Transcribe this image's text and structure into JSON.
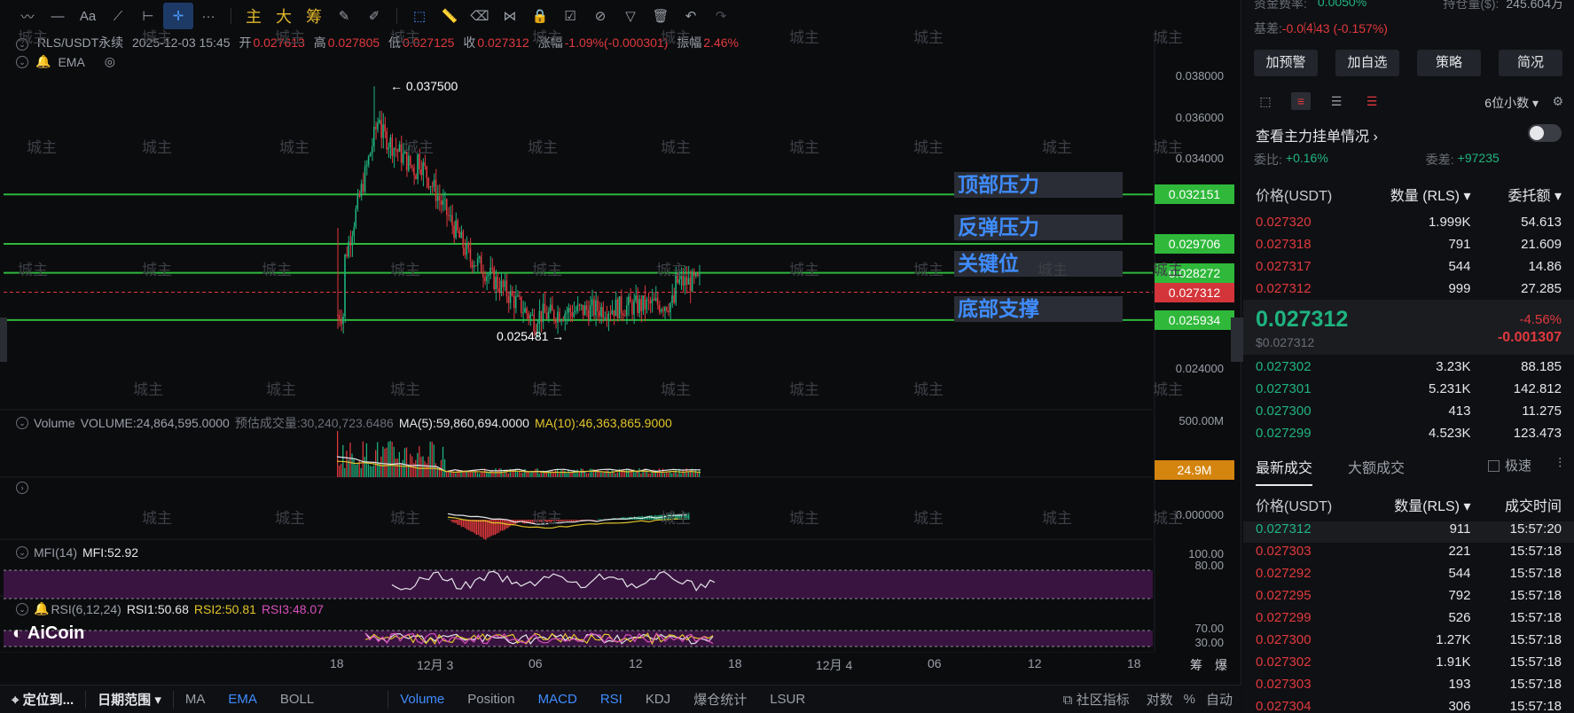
{
  "toolbar": {
    "items": [
      "draw-line",
      "horizontal-line",
      "text",
      "fib",
      "ray",
      "crosshair",
      "more"
    ],
    "highlights": [
      "主",
      "大",
      "筹"
    ]
  },
  "info": {
    "symbol": "RLS/USDT永续",
    "datetime": "2025-12-03 15:45",
    "open_label": "开",
    "open": "0.027613",
    "high_label": "高",
    "high": "0.027805",
    "low_label": "低",
    "low": "0.027125",
    "close_label": "收",
    "close": "0.027312",
    "change_label": "涨幅",
    "change": "-1.09%(-0.000301)",
    "amp_label": "振幅",
    "amp": "2.46%",
    "ema_label": "EMA"
  },
  "price_axis": [
    "0.038000",
    "0.036000",
    "0.034000",
    "0.032151",
    "0.029706",
    "0.028272",
    "0.027312",
    "0.025934",
    "0.024000"
  ],
  "levels": [
    {
      "price": "0.032151",
      "zone": "顶部压力",
      "color": "#2db83d"
    },
    {
      "price": "0.029706",
      "zone": "反弹压力",
      "color": "#2db83d"
    },
    {
      "price": "0.028272",
      "zone": "关键位",
      "color": "#2db83d"
    },
    {
      "price": "0.027312",
      "zone": "",
      "color": "#e0393e"
    },
    {
      "price": "0.025934",
      "zone": "底部支撑",
      "color": "#2db83d"
    }
  ],
  "high_marker": "0.037500",
  "low_marker": "0.025481",
  "volume": {
    "label": "Volume",
    "value": "VOLUME:24,864,595.0000",
    "est": "预估成交量:30,240,723.6486",
    "ma5": "MA(5):59,860,694.0000",
    "ma10": "MA(10):46,363,865.9000",
    "axis_top": "500.00M",
    "current": "24.9M"
  },
  "macd": {
    "axis": "0.000000"
  },
  "mfi": {
    "label": "MFI(14)",
    "value": "MFI:52.92",
    "axis_100": "100.00",
    "axis_80": "80.00"
  },
  "rsi": {
    "label": "RSI(6,12,24)",
    "rsi1": "RSI1:50.68",
    "rsi2": "RSI2:50.81",
    "rsi3": "RSI3:48.07",
    "axis_70": "70.00",
    "axis_30": "30.00"
  },
  "brand": "AiCoin",
  "watermark": "城主",
  "x_axis": [
    "18",
    "12月 3",
    "06",
    "12",
    "18",
    "12月 4",
    "06",
    "12",
    "18"
  ],
  "x_axis_right": [
    "筹",
    "爆"
  ],
  "bottom": {
    "locate": "定位到...",
    "range": "日期范围",
    "indicators": [
      "MA",
      "EMA",
      "BOLL"
    ],
    "sub": [
      "Volume",
      "Position",
      "MACD",
      "RSI",
      "KDJ",
      "爆仓统计",
      "LSUR"
    ],
    "community": "社区指标",
    "log": "对数",
    "percent": "%",
    "auto": "自动"
  },
  "panel": {
    "funding_label": "资金费率:",
    "funding": "0.0050%",
    "oi_label": "持仓量($):",
    "oi": "245.604万",
    "basis_label": "基差:",
    "basis": "-0.0⑷43 (-0.157%)",
    "buttons": [
      "加预警",
      "加自选",
      "策略",
      "简况"
    ],
    "decimals": "6位小数",
    "main_orders": "查看主力挂单情况",
    "ratio_label": "委比:",
    "ratio": "+0.16%",
    "diff_label": "委差:",
    "diff": "+97235",
    "ob_headers": [
      "价格(USDT)",
      "数量 (RLS)",
      "委托额"
    ],
    "asks": [
      [
        "0.027320",
        "1.999K",
        "54.613"
      ],
      [
        "0.027318",
        "791",
        "21.609"
      ],
      [
        "0.027317",
        "544",
        "14.86"
      ],
      [
        "0.027312",
        "999",
        "27.285"
      ]
    ],
    "last_price": "0.027312",
    "last_usd": "$0.027312",
    "last_pct": "-4.56%",
    "last_chg": "-0.001307",
    "bids": [
      [
        "0.027302",
        "3.23K",
        "88.185"
      ],
      [
        "0.027301",
        "5.231K",
        "142.812"
      ],
      [
        "0.027300",
        "413",
        "11.275"
      ],
      [
        "0.027299",
        "4.523K",
        "123.473"
      ]
    ],
    "tabs": [
      "最新成交",
      "大额成交"
    ],
    "fast": "极速",
    "trade_headers": [
      "价格(USDT)",
      "数量(RLS)",
      "成交时间"
    ],
    "trades": [
      [
        "0.027312",
        "911",
        "15:57:20"
      ],
      [
        "0.027303",
        "221",
        "15:57:18"
      ],
      [
        "0.027292",
        "544",
        "15:57:18"
      ],
      [
        "0.027295",
        "792",
        "15:57:18"
      ],
      [
        "0.027299",
        "526",
        "15:57:18"
      ],
      [
        "0.027300",
        "1.27K",
        "15:57:18"
      ],
      [
        "0.027302",
        "1.91K",
        "15:57:18"
      ],
      [
        "0.027303",
        "193",
        "15:57:18"
      ],
      [
        "0.027304",
        "306",
        "15:57:18"
      ]
    ]
  }
}
